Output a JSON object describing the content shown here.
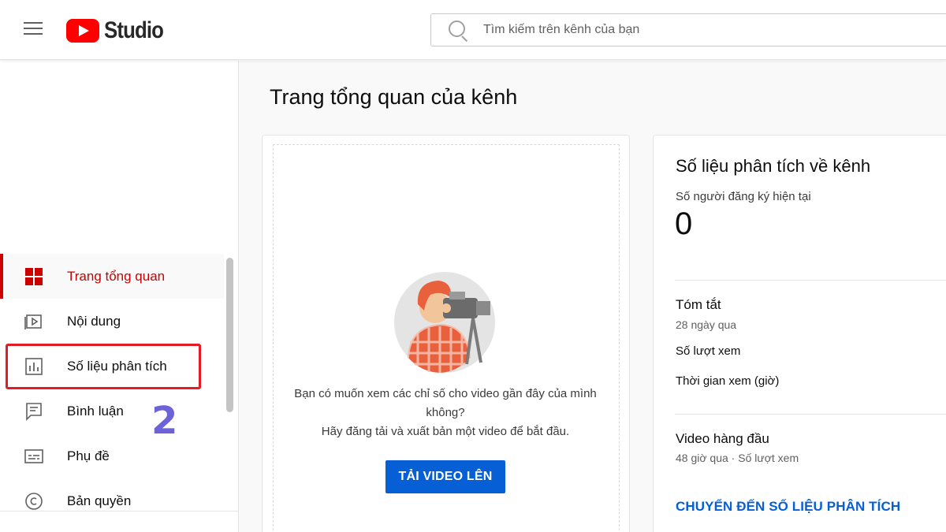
{
  "header": {
    "logo_text": "Studio",
    "search_placeholder": "Tìm kiếm trên kênh của bạn"
  },
  "sidebar": {
    "items": [
      {
        "label": "Trang tổng quan",
        "icon": "dashboard-icon",
        "active": true
      },
      {
        "label": "Nội dung",
        "icon": "content-icon"
      },
      {
        "label": "Số liệu phân tích",
        "icon": "analytics-icon"
      },
      {
        "label": "Bình luận",
        "icon": "comments-icon"
      },
      {
        "label": "Phụ đề",
        "icon": "subtitles-icon"
      },
      {
        "label": "Bản quyền",
        "icon": "copyright-icon"
      }
    ]
  },
  "annotation": {
    "step_number": "2"
  },
  "main": {
    "page_title": "Trang tổng quan của kênh",
    "empty_state": {
      "line1": "Bạn có muốn xem các chỉ số cho video gần đây của mình",
      "line2": "không?",
      "line3": "Hãy đăng tải và xuất bản một video để bắt đầu.",
      "button_label": "TẢI VIDEO LÊN"
    },
    "analytics": {
      "title": "Số liệu phân tích về kênh",
      "subscribers_label": "Số người đăng ký hiện tại",
      "subscribers_value": "0",
      "summary_title": "Tóm tắt",
      "summary_period": "28 ngày qua",
      "views_label": "Số lượt xem",
      "watch_time_label": "Thời gian xem (giờ)",
      "top_videos_title": "Video hàng đầu",
      "top_videos_sub": "48 giờ qua · Số lượt xem",
      "link_label": "CHUYỂN ĐẾN SỐ LIỆU PHÂN TÍCH"
    }
  },
  "colors": {
    "brand_red": "#ff0000",
    "active_red": "#cc0000",
    "accent_blue": "#065fd4",
    "highlight_red": "#e51b23",
    "annotation_purple": "#6c63d8"
  }
}
